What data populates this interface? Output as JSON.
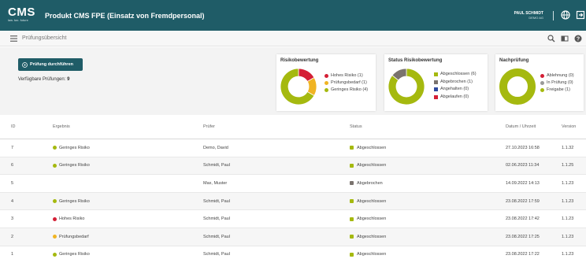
{
  "header": {
    "logo_text": "CMS",
    "logo_tagline": "law. tax. future",
    "app_title": "Produkt CMS FPE (Einsatz von Fremdpersonal)",
    "user_name": "PAUL SCHMIDT",
    "user_company": "DEMO AG"
  },
  "subheader": {
    "title": "Prüfungsübersicht"
  },
  "dashboard": {
    "run_button_label": "Prüfung durchführen",
    "available_label": "Verfügbare Prüfungen:",
    "available_count": "9",
    "cards": [
      {
        "title": "Risikobewertung",
        "legend": [
          {
            "label": "Hohes Risiko (1)",
            "color": "#d41f35",
            "value": 1
          },
          {
            "label": "Prüfungsbedarf (1)",
            "color": "#f0b423",
            "value": 1
          },
          {
            "label": "Geringes Risiko (4)",
            "color": "#a5b90f",
            "value": 4
          }
        ]
      },
      {
        "title": "Status Risikobewertung",
        "legend": [
          {
            "label": "Abgeschlossen (6)",
            "color": "#a5b90f",
            "value": 6
          },
          {
            "label": "Abgebrochen (1)",
            "color": "#7a736e",
            "value": 1
          },
          {
            "label": "Angehalten (0)",
            "color": "#2e4a9e",
            "value": 0
          },
          {
            "label": "Abgelaufen (0)",
            "color": "#d41f35",
            "value": 0
          }
        ]
      },
      {
        "title": "Nachprüfung",
        "legend": [
          {
            "label": "Ablehnung (0)",
            "color": "#d41f35",
            "value": 0
          },
          {
            "label": "In Prüfung (0)",
            "color": "#999999",
            "value": 0
          },
          {
            "label": "Freigabe (1)",
            "color": "#a5b90f",
            "value": 1
          }
        ]
      }
    ]
  },
  "table": {
    "columns": [
      "ID",
      "Ergebnis",
      "Prüfer",
      "Status",
      "Datum / Uhrzeit",
      "Version"
    ],
    "rows": [
      {
        "id": "7",
        "ergebnis": "Geringes Risiko",
        "ergebnis_color": "#a5b90f",
        "pruefer": "Demo, David",
        "status": "Abgeschlossen",
        "status_color": "#a5b90f",
        "datum": "27.10.2023 16:58",
        "version": "1.1.32"
      },
      {
        "id": "6",
        "ergebnis": "Geringes Risiko",
        "ergebnis_color": "#a5b90f",
        "pruefer": "Schmidt, Paul",
        "status": "Abgeschlossen",
        "status_color": "#a5b90f",
        "datum": "02.06.2023 11:34",
        "version": "1.1.25"
      },
      {
        "id": "5",
        "ergebnis": "",
        "ergebnis_color": "",
        "pruefer": "Max, Muster",
        "status": "Abgebrochen",
        "status_color": "#7a736e",
        "datum": "14.09.2022 14:13",
        "version": "1.1.23"
      },
      {
        "id": "4",
        "ergebnis": "Geringes Risiko",
        "ergebnis_color": "#a5b90f",
        "pruefer": "Schmidt, Paul",
        "status": "Abgeschlossen",
        "status_color": "#a5b90f",
        "datum": "23.08.2022 17:59",
        "version": "1.1.23"
      },
      {
        "id": "3",
        "ergebnis": "Hohes Risiko",
        "ergebnis_color": "#d41f35",
        "pruefer": "Schmidt, Paul",
        "status": "Abgeschlossen",
        "status_color": "#a5b90f",
        "datum": "23.08.2022 17:42",
        "version": "1.1.23"
      },
      {
        "id": "2",
        "ergebnis": "Prüfungsbedarf",
        "ergebnis_color": "#f0b423",
        "pruefer": "Schmidt, Paul",
        "status": "Abgeschlossen",
        "status_color": "#a5b90f",
        "datum": "23.08.2022 17:25",
        "version": "1.1.23"
      },
      {
        "id": "1",
        "ergebnis": "Geringes Risiko",
        "ergebnis_color": "#a5b90f",
        "pruefer": "Schmidt, Paul",
        "status": "Abgeschlossen",
        "status_color": "#a5b90f",
        "datum": "23.08.2022 17:22",
        "version": "1.1.23"
      }
    ]
  },
  "colors": {
    "brand": "#1f5c67",
    "green": "#a5b90f",
    "red": "#d41f35",
    "yellow": "#f0b423",
    "grey": "#7a736e"
  },
  "icons": [
    "globe-icon",
    "logout-icon",
    "menu-icon",
    "search-icon",
    "view-toggle-icon",
    "help-icon",
    "play-circle-icon"
  ]
}
